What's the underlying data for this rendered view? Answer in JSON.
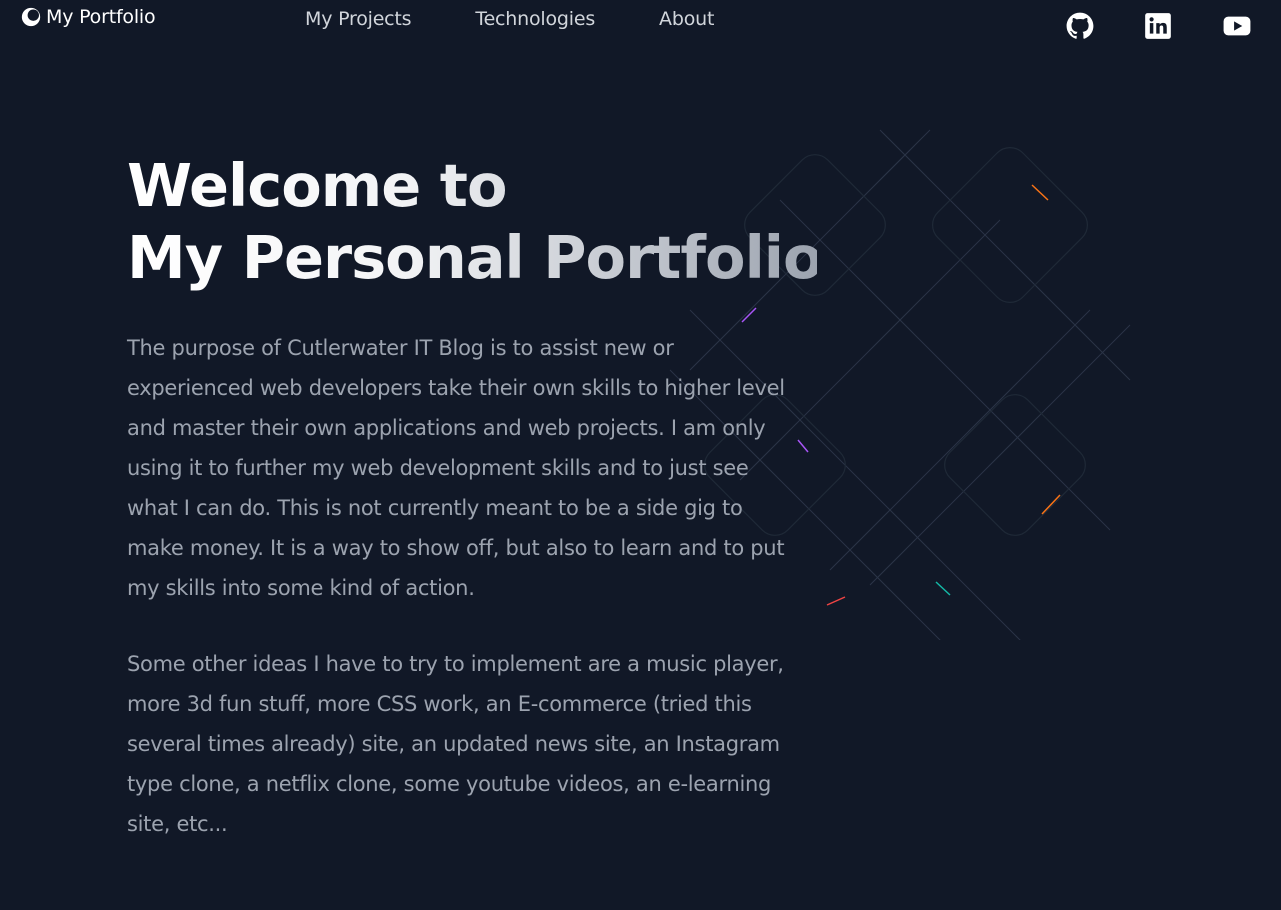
{
  "brand": {
    "name": "My Portfolio",
    "logo_icon": "moon-half-icon"
  },
  "nav": {
    "links": [
      {
        "label": "My Projects"
      },
      {
        "label": "Technologies"
      },
      {
        "label": "About"
      }
    ]
  },
  "socials": [
    {
      "icon": "github-icon"
    },
    {
      "icon": "linkedin-icon"
    },
    {
      "icon": "youtube-icon"
    }
  ],
  "hero": {
    "title_line_1": "Welcome to",
    "title_line_2": "My Personal Portfolio",
    "paragraph_1": "The purpose of Cutlerwater IT Blog is to assist new or experienced web developers take their own skills to higher level and master their own applications and web projects. I am only using it to further my web development skills and to just see what I can do. This is not currently meant to be a side gig to make money. It is a way to show off, but also to learn and to put my skills into some kind of action.",
    "paragraph_2": "Some other ideas I have to try to implement are a music player, more 3d fun stuff, more CSS work, an E-commerce (tried this several times already) site, an updated news site, an Instagram type clone, a netflix clone, some youtube videos, an e-learning site, etc..."
  },
  "colors": {
    "background": "#111827",
    "body_text": "#9ca3af",
    "accent_orange": "#f97316",
    "accent_purple": "#a855f7",
    "accent_teal": "#14b8a6"
  }
}
